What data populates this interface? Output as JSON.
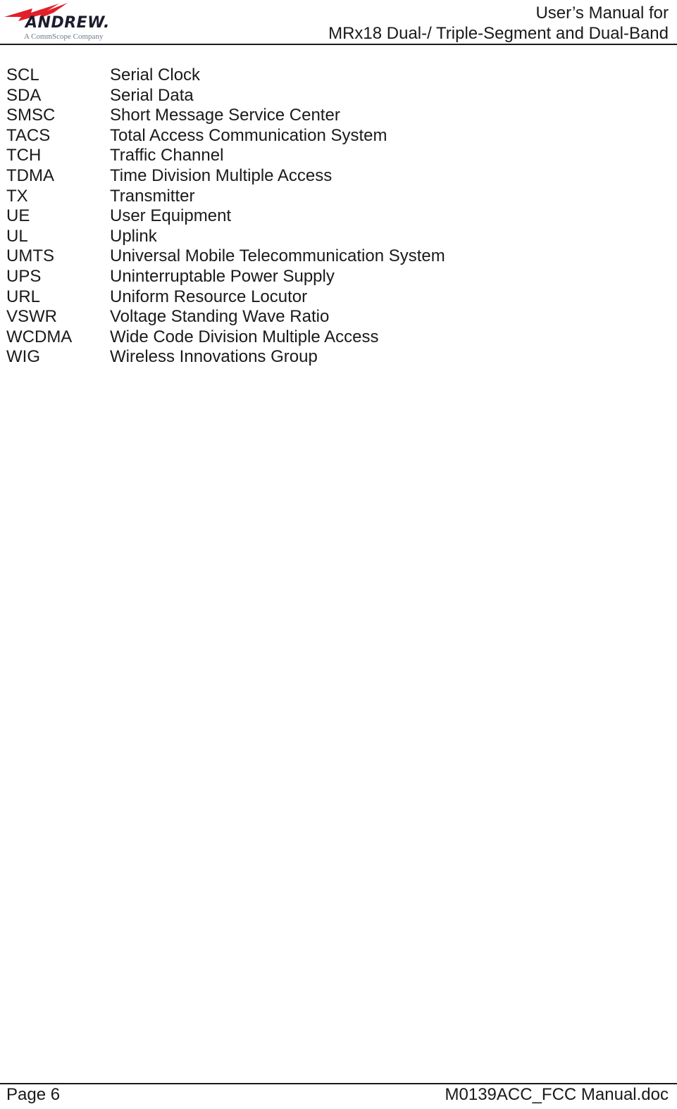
{
  "header": {
    "logo": {
      "brand": "ANDREW.",
      "tagline": "A CommScope Company",
      "icon": "lightning-bolt-icon",
      "brand_color": "#e0202a"
    },
    "title_line1": "User’s Manual for",
    "title_line2": "MRx18 Dual-/ Triple-Segment and Dual-Band"
  },
  "glossary": [
    {
      "abbr": "SCL",
      "definition": "Serial Clock"
    },
    {
      "abbr": "SDA",
      "definition": "Serial Data"
    },
    {
      "abbr": "SMSC",
      "definition": "Short Message Service Center"
    },
    {
      "abbr": "TACS",
      "definition": "Total Access Communication System"
    },
    {
      "abbr": "TCH",
      "definition": "Traffic Channel"
    },
    {
      "abbr": "TDMA",
      "definition": "Time Division Multiple Access"
    },
    {
      "abbr": "TX",
      "definition": "Transmitter"
    },
    {
      "abbr": "UE",
      "definition": "User Equipment"
    },
    {
      "abbr": "UL",
      "definition": "Uplink"
    },
    {
      "abbr": "UMTS",
      "definition": "Universal Mobile Telecommunication System"
    },
    {
      "abbr": "UPS",
      "definition": "Uninterruptable Power Supply"
    },
    {
      "abbr": "URL",
      "definition": "Uniform Resource Locutor"
    },
    {
      "abbr": "VSWR",
      "definition": "Voltage Standing Wave Ratio"
    },
    {
      "abbr": "WCDMA",
      "definition": "Wide Code Division Multiple Access"
    },
    {
      "abbr": "WIG",
      "definition": "Wireless Innovations Group"
    }
  ],
  "footer": {
    "page": "Page 6",
    "filename": "M0139ACC_FCC Manual.doc"
  }
}
